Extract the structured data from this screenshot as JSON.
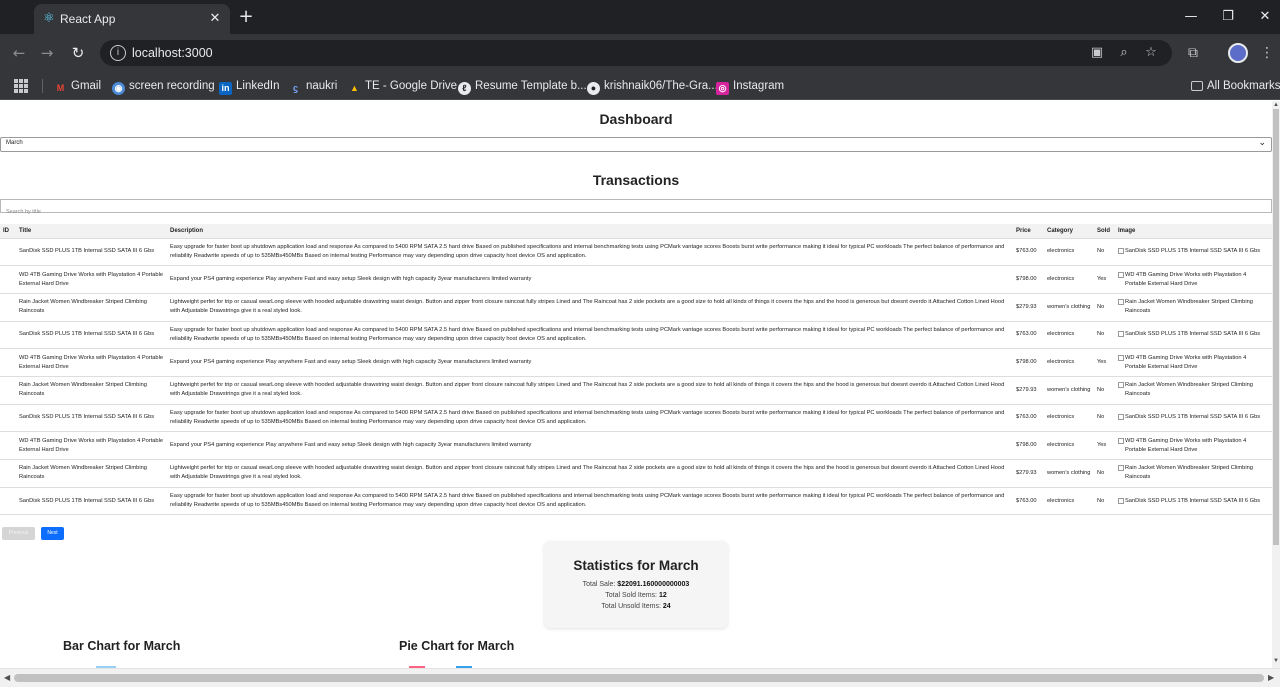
{
  "browser": {
    "tab_title": "React App",
    "url": "localhost:3000",
    "bookmarks": [
      {
        "label": "Gmail",
        "icon": "gmail-icon"
      },
      {
        "label": "screen recording",
        "icon": "recording-icon"
      },
      {
        "label": "LinkedIn",
        "icon": "linkedin-icon"
      },
      {
        "label": "naukri",
        "icon": "naukri-icon"
      },
      {
        "label": "TE - Google Drive",
        "icon": "drive-icon"
      },
      {
        "label": "Resume Template b...",
        "icon": "resume-icon"
      },
      {
        "label": "krishnaik06/The-Gra...",
        "icon": "github-icon"
      },
      {
        "label": "Instagram",
        "icon": "instagram-icon"
      }
    ],
    "all_bookmarks": "All Bookmarks"
  },
  "dashboard": {
    "title": "Dashboard",
    "selected_month": "March"
  },
  "transactions": {
    "title": "Transactions",
    "search_placeholder": "Search by title",
    "columns": [
      "ID",
      "Title",
      "Description",
      "Price",
      "Category",
      "Sold",
      "Image"
    ],
    "rows": [
      {
        "id": "",
        "title": "SanDisk SSD PLUS 1TB Internal SSD SATA III 6 Gbs",
        "description": "Easy upgrade for faster boot up shutdown application load and response As compared to 5400 RPM SATA 2.5 hard drive Based on published specifications and internal benchmarking tests using PCMark vantage scores Boosts burst write performance making it ideal for typical PC workloads The perfect balance of performance and reliability Readwrite speeds of up to 535MBs450MBs Based on internal testing Performance may vary depending upon drive capacity host device OS and application.",
        "price": "$763.00",
        "category": "electronics",
        "sold": "No",
        "image_alt": "SanDisk SSD PLUS 1TB Internal SSD SATA III 6 Gbs"
      },
      {
        "id": "",
        "title": "WD 4TB Gaming Drive Works with Playstation 4 Portable External Hard Drive",
        "description": "Expand your PS4 gaming experience Play anywhere Fast and easy setup Sleek design with high capacity 3year manufacturers limited warranty",
        "price": "$798.00",
        "category": "electronics",
        "sold": "Yes",
        "image_alt": "WD 4TB Gaming Drive Works with Playstation 4 Portable External Hard Drive"
      },
      {
        "id": "",
        "title": "Rain Jacket Women Windbreaker Striped Climbing Raincoats",
        "description": "Lightweight perfet for trip or casual wearLong sleeve with hooded adjustable drawstring waist design. Button and zipper front closure raincoat fully stripes Lined and The Raincoat has 2 side pockets are a good size to hold all kinds of things it covers the hips and the hood is generous but doesnt overdo it.Attached Cotton Lined Hood with Adjustable Drawstrings give it a real styled look.",
        "price": "$279.93",
        "category": "women's clothing",
        "sold": "No",
        "image_alt": "Rain Jacket Women Windbreaker Striped Climbing Raincoats"
      },
      {
        "id": "",
        "title": "SanDisk SSD PLUS 1TB Internal SSD SATA III 6 Gbs",
        "description": "Easy upgrade for faster boot up shutdown application load and response As compared to 5400 RPM SATA 2.5 hard drive Based on published specifications and internal benchmarking tests using PCMark vantage scores Boosts burst write performance making it ideal for typical PC workloads The perfect balance of performance and reliability Readwrite speeds of up to 535MBs450MBs Based on internal testing Performance may vary depending upon drive capacity host device OS and application.",
        "price": "$763.00",
        "category": "electronics",
        "sold": "No",
        "image_alt": "SanDisk SSD PLUS 1TB Internal SSD SATA III 6 Gbs"
      },
      {
        "id": "",
        "title": "WD 4TB Gaming Drive Works with Playstation 4 Portable External Hard Drive",
        "description": "Expand your PS4 gaming experience Play anywhere Fast and easy setup Sleek design with high capacity 3year manufacturers limited warranty",
        "price": "$798.00",
        "category": "electronics",
        "sold": "Yes",
        "image_alt": "WD 4TB Gaming Drive Works with Playstation 4 Portable External Hard Drive"
      },
      {
        "id": "",
        "title": "Rain Jacket Women Windbreaker Striped Climbing Raincoats",
        "description": "Lightweight perfet for trip or casual wearLong sleeve with hooded adjustable drawstring waist design. Button and zipper front closure raincoat fully stripes Lined and The Raincoat has 2 side pockets are a good size to hold all kinds of things it covers the hips and the hood is generous but doesnt overdo it.Attached Cotton Lined Hood with Adjustable Drawstrings give it a real styled look.",
        "price": "$279.93",
        "category": "women's clothing",
        "sold": "No",
        "image_alt": "Rain Jacket Women Windbreaker Striped Climbing Raincoats"
      },
      {
        "id": "",
        "title": "SanDisk SSD PLUS 1TB Internal SSD SATA III 6 Gbs",
        "description": "Easy upgrade for faster boot up shutdown application load and response As compared to 5400 RPM SATA 2.5 hard drive Based on published specifications and internal benchmarking tests using PCMark vantage scores Boosts burst write performance making it ideal for typical PC workloads The perfect balance of performance and reliability Readwrite speeds of up to 535MBs450MBs Based on internal testing Performance may vary depending upon drive capacity host device OS and application.",
        "price": "$763.00",
        "category": "electronics",
        "sold": "No",
        "image_alt": "SanDisk SSD PLUS 1TB Internal SSD SATA III 6 Gbs"
      },
      {
        "id": "",
        "title": "WD 4TB Gaming Drive Works with Playstation 4 Portable External Hard Drive",
        "description": "Expand your PS4 gaming experience Play anywhere Fast and easy setup Sleek design with high capacity 3year manufacturers limited warranty",
        "price": "$798.00",
        "category": "electronics",
        "sold": "Yes",
        "image_alt": "WD 4TB Gaming Drive Works with Playstation 4 Portable External Hard Drive"
      },
      {
        "id": "",
        "title": "Rain Jacket Women Windbreaker Striped Climbing Raincoats",
        "description": "Lightweight perfet for trip or casual wearLong sleeve with hooded adjustable drawstring waist design. Button and zipper front closure raincoat fully stripes Lined and The Raincoat has 2 side pockets are a good size to hold all kinds of things it covers the hips and the hood is generous but doesnt overdo it.Attached Cotton Lined Hood with Adjustable Drawstrings give it a real styled look.",
        "price": "$279.93",
        "category": "women's clothing",
        "sold": "No",
        "image_alt": "Rain Jacket Women Windbreaker Striped Climbing Raincoats"
      },
      {
        "id": "",
        "title": "SanDisk SSD PLUS 1TB Internal SSD SATA III 6 Gbs",
        "description": "Easy upgrade for faster boot up shutdown application load and response As compared to 5400 RPM SATA 2.5 hard drive Based on published specifications and internal benchmarking tests using PCMark vantage scores Boosts burst write performance making it ideal for typical PC workloads The perfect balance of performance and reliability Readwrite speeds of up to 535MBs450MBs Based on internal testing Performance may vary depending upon drive capacity host device OS and application.",
        "price": "$763.00",
        "category": "electronics",
        "sold": "No",
        "image_alt": "SanDisk SSD PLUS 1TB Internal SSD SATA III 6 Gbs"
      }
    ],
    "previous_label": "Previous",
    "next_label": "Next"
  },
  "statistics": {
    "title": "Statistics for March",
    "total_sale_label": "Total Sale:",
    "total_sale_value": "$22091.160000000003",
    "total_sold_label": "Total Sold Items:",
    "total_sold_value": "12",
    "total_unsold_label": "Total Unsold Items:",
    "total_unsold_value": "24"
  },
  "charts": {
    "bar_title": "Bar Chart for March",
    "pie_title": "Pie Chart for March",
    "bar_legend_color": "#9ad0f5",
    "pie_legend_colors": [
      "#ff6384",
      "#36a2eb"
    ]
  },
  "colors": {
    "accent": "#0d6efd",
    "chrome_dark": "#202124",
    "chrome_mid": "#35363a"
  }
}
